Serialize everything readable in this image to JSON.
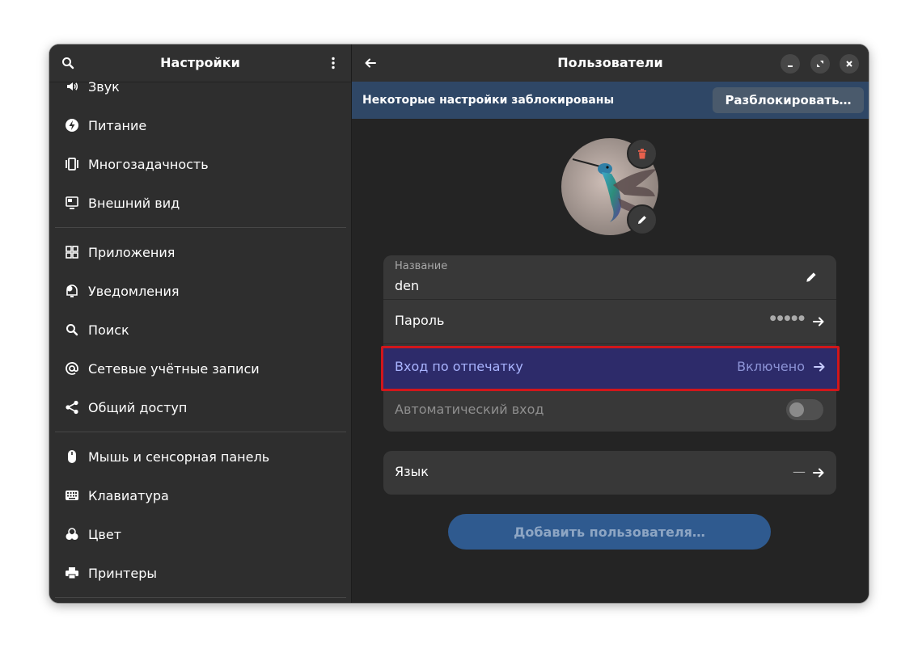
{
  "sidebar": {
    "title": "Настройки",
    "items": [
      {
        "label": "Звук",
        "icon": "speaker-icon"
      },
      {
        "label": "Питание",
        "icon": "power-icon"
      },
      {
        "label": "Многозадачность",
        "icon": "multitasking-icon"
      },
      {
        "label": "Внешний вид",
        "icon": "appearance-icon"
      },
      {
        "label": "Приложения",
        "icon": "apps-icon"
      },
      {
        "label": "Уведомления",
        "icon": "notifications-icon"
      },
      {
        "label": "Поиск",
        "icon": "search-icon"
      },
      {
        "label": "Сетевые учётные записи",
        "icon": "at-icon"
      },
      {
        "label": "Общий доступ",
        "icon": "share-icon"
      },
      {
        "label": "Мышь и сенсорная панель",
        "icon": "mouse-icon"
      },
      {
        "label": "Клавиатура",
        "icon": "keyboard-icon"
      },
      {
        "label": "Цвет",
        "icon": "color-icon"
      },
      {
        "label": "Принтеры",
        "icon": "printer-icon"
      }
    ]
  },
  "main": {
    "title": "Пользователи",
    "banner": {
      "text": "Некоторые настройки заблокированы",
      "button": "Разблокировать…"
    },
    "user": {
      "name_label": "Название",
      "name_value": "den",
      "password_label": "Пароль",
      "password_value": "●●●●●",
      "fingerprint_label": "Вход по отпечатку",
      "fingerprint_value": "Включено",
      "autologin_label": "Автоматический вход",
      "autologin_enabled": false
    },
    "language": {
      "label": "Язык",
      "value": "—"
    },
    "add_user_button": "Добавить пользователя…"
  },
  "colors": {
    "accent": "#2f5a8f",
    "banner": "#2f4766",
    "highlight_border": "#d1161b",
    "delete_icon": "#e8604c"
  }
}
